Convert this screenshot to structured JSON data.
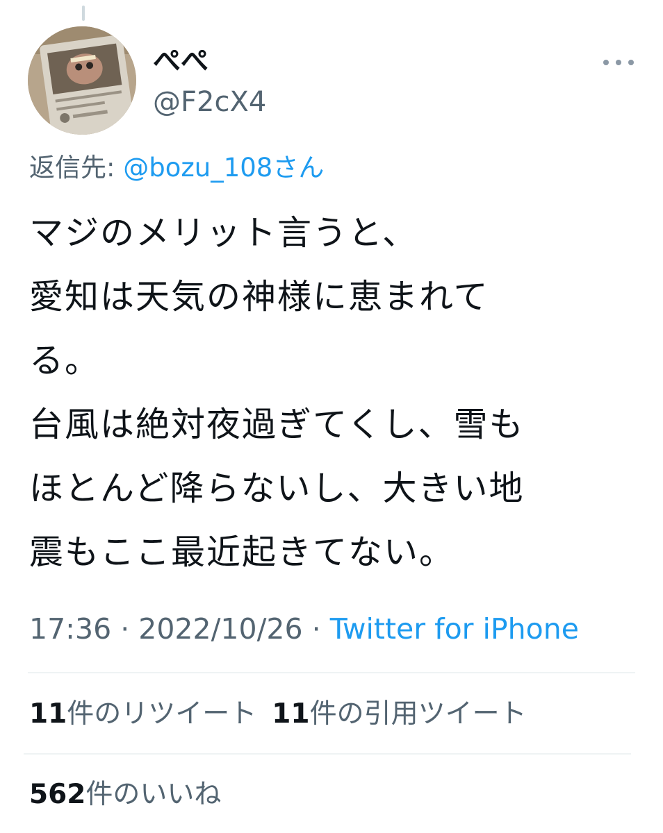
{
  "tweet": {
    "display_name": "ぺぺ",
    "handle": "@F2cX4",
    "reply_to_label": "返信先:",
    "reply_to_mention": "@bozu_108さん",
    "text": "マジのメリット言うと、\n愛知は天気の神様に恵まれて\nる。\n台風は絶対夜過ぎてくし、雪も\nほとんど降らないし、大きい地\n震もここ最近起きてない。",
    "time": "17:36",
    "separator": " · ",
    "date": "2022/10/26",
    "source": "Twitter for iPhone"
  },
  "stats": {
    "retweets_count": "11",
    "retweets_label": "件のリツイート",
    "quotes_count": "11",
    "quotes_label": "件の引用ツイート",
    "likes_count": "562",
    "likes_label": "件のいいね"
  },
  "icons": {
    "more": "more-horizontal-icon",
    "avatar": "avatar-image"
  },
  "colors": {
    "link": "#1d9bf0",
    "secondary_text": "#536471",
    "primary_text": "#0f1419",
    "divider": "#eff3f4"
  }
}
